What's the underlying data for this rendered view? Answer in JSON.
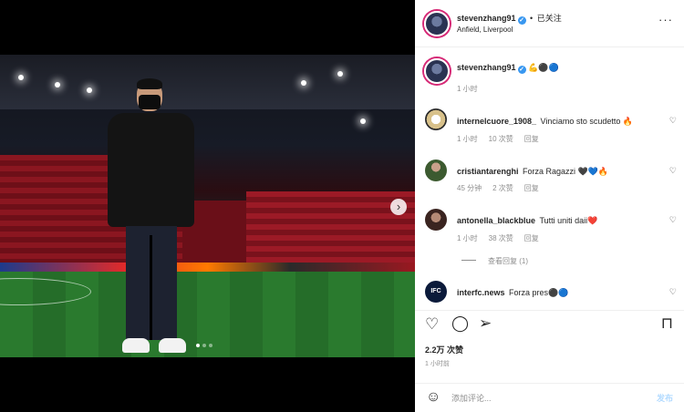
{
  "header": {
    "username": "stevenzhang91",
    "separator": "•",
    "follow_label": "已关注",
    "location": "Anfield, Liverpool",
    "more_icon": "more-horizontal-icon"
  },
  "caption": {
    "username": "stevenzhang91",
    "emoji": "💪⚫🔵",
    "time": "1 小时"
  },
  "comments": [
    {
      "username": "internelcuore_1908_",
      "text": "Vinciamo sto scudetto 🔥",
      "time": "1 小时",
      "likes": "10 次赞",
      "reply": "回复"
    },
    {
      "username": "cristiantarenghi",
      "text": "Forza Ragazzi 🖤💙🔥",
      "time": "45 分钟",
      "likes": "2 次赞",
      "reply": "回复"
    },
    {
      "username": "antonella_blackblue",
      "text": "Tutti uniti daii❤️",
      "time": "1 小时",
      "likes": "38 次赞",
      "reply": "回复",
      "view_replies": "查看回复 (1)"
    },
    {
      "username": "interfc.news",
      "text": "Forza pres⚫🔵"
    }
  ],
  "actions": {
    "likes": "2.2万 次赞",
    "time": "1 小时前"
  },
  "add_comment": {
    "placeholder": "添加评论...",
    "post_label": "发布"
  },
  "colors": {
    "accent": "#0095f6",
    "post_disabled": "#b3dbff",
    "muted": "#8e8e8e"
  }
}
